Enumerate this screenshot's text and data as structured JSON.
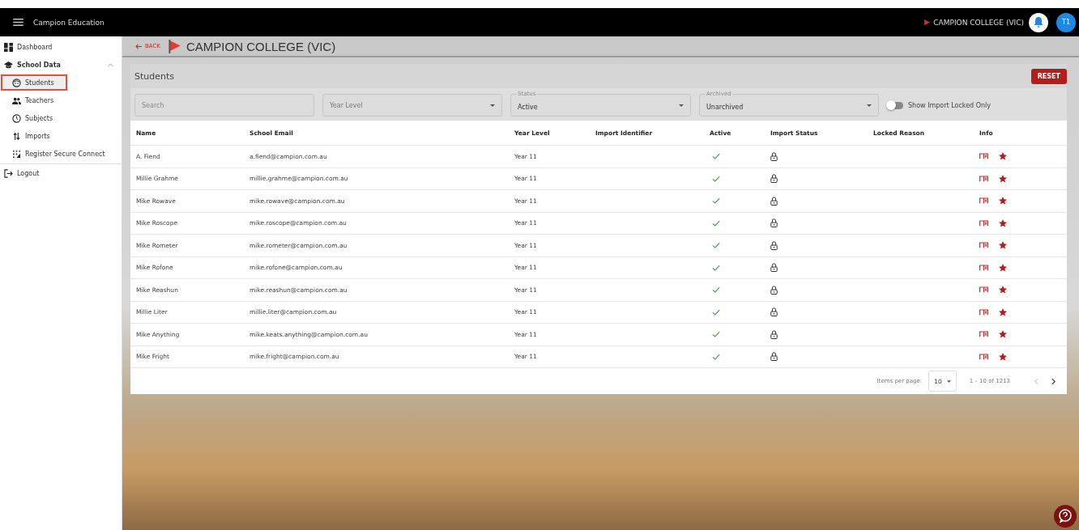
{
  "app_bar": {
    "title": "Campion Education",
    "school": "CAMPION COLLEGE (VIC)",
    "avatar": "T1"
  },
  "sidebar": {
    "items": [
      {
        "label": "Dashboard",
        "selected": false
      },
      {
        "label": "School Data",
        "selected": false,
        "expanded": true,
        "children": [
          {
            "label": "Students",
            "selected": true
          },
          {
            "label": "Teachers",
            "selected": false
          },
          {
            "label": "Subjects",
            "selected": false
          },
          {
            "label": "Imports",
            "selected": false
          },
          {
            "label": "Register Secure Connect",
            "selected": false
          }
        ]
      }
    ],
    "logout": "Logout"
  },
  "header": {
    "back": "BACK",
    "title": "CAMPION COLLEGE (VIC)"
  },
  "panel": {
    "title": "Students",
    "reset": "RESET",
    "filters": [
      {
        "kind": "text",
        "placeholder": "Search"
      },
      {
        "kind": "select",
        "placeholder": "Year Level"
      },
      {
        "kind": "select",
        "label": "Status",
        "value": "Active"
      },
      {
        "kind": "select",
        "label": "Archived",
        "value": "Unarchived"
      }
    ],
    "toggle": {
      "label": "Show Import Locked Only",
      "on": false
    }
  },
  "table": {
    "columns": [
      "Name",
      "School Email",
      "Year Level",
      "Import Identifier",
      "Active",
      "Import Status",
      "Locked Reason",
      "Info"
    ],
    "rows": [
      {
        "name": "A. Fiend",
        "email": "a.fiend@campion.com.au",
        "year": "Year 11",
        "active": true,
        "locked": true
      },
      {
        "name": "Millie Grahme",
        "email": "millie.grahme@campion.com.au",
        "year": "Year 11",
        "active": true,
        "locked": true
      },
      {
        "name": "Mike Rowave",
        "email": "mike.rowave@campion.com.au",
        "year": "Year 11",
        "active": true,
        "locked": true
      },
      {
        "name": "Mike Roscope",
        "email": "mike.roscope@campion.com.au",
        "year": "Year 11",
        "active": true,
        "locked": true
      },
      {
        "name": "Mike Rometer",
        "email": "mike.rometer@campion.com.au",
        "year": "Year 11",
        "active": true,
        "locked": true
      },
      {
        "name": "Mike Rofone",
        "email": "mike.rofone@campion.com.au",
        "year": "Year 11",
        "active": true,
        "locked": true
      },
      {
        "name": "Mike Reashun",
        "email": "mike.reashun@campion.com.au",
        "year": "Year 11",
        "active": true,
        "locked": true
      },
      {
        "name": "Millie Liter",
        "email": "millie.liter@campion.com.au",
        "year": "Year 11",
        "active": true,
        "locked": true
      },
      {
        "name": "Mike Anything",
        "email": "mike.keats.anything@campion.com.au",
        "year": "Year 11",
        "active": true,
        "locked": true
      },
      {
        "name": "Mike Fright",
        "email": "mike.fright@campion.com.au",
        "year": "Year 11",
        "active": true,
        "locked": true
      }
    ]
  },
  "pagination": {
    "label": "Items per page:",
    "per_page": "10",
    "range": "1 – 10 of 1213"
  }
}
